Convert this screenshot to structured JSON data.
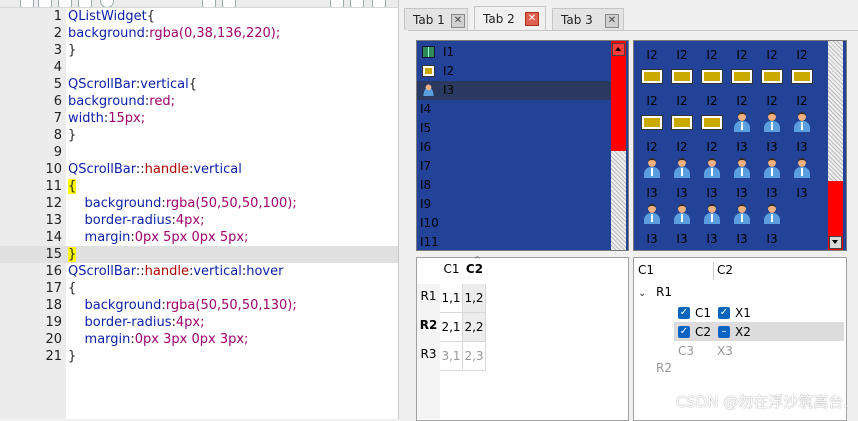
{
  "editor": {
    "lines": [
      {
        "n": "1",
        "parts": [
          [
            "sel",
            "QListWidget"
          ],
          [
            "brace",
            "{"
          ]
        ]
      },
      {
        "n": "2",
        "parts": [
          [
            "prop",
            "background"
          ],
          [
            "brace",
            ":"
          ],
          [
            "val",
            "rgba(0,38,136,220);"
          ]
        ]
      },
      {
        "n": "3",
        "parts": [
          [
            "brace",
            "}"
          ]
        ]
      },
      {
        "n": "4",
        "parts": []
      },
      {
        "n": "5",
        "parts": [
          [
            "sel",
            "QScrollBar"
          ],
          [
            "brace",
            ":"
          ],
          [
            "sel",
            "vertical"
          ],
          [
            "brace",
            "{"
          ]
        ]
      },
      {
        "n": "6",
        "parts": [
          [
            "prop",
            "background"
          ],
          [
            "brace",
            ":"
          ],
          [
            "val",
            "red;"
          ]
        ]
      },
      {
        "n": "7",
        "parts": [
          [
            "prop",
            "width"
          ],
          [
            "brace",
            ":"
          ],
          [
            "val",
            "15px;"
          ]
        ]
      },
      {
        "n": "8",
        "parts": [
          [
            "brace",
            "}"
          ]
        ]
      },
      {
        "n": "9",
        "parts": []
      },
      {
        "n": "10",
        "parts": [
          [
            "sel",
            "QScrollBar"
          ],
          [
            "brace",
            "::"
          ],
          [
            "pseudo",
            "handle"
          ],
          [
            "brace",
            ":"
          ],
          [
            "sel",
            "vertical"
          ]
        ]
      },
      {
        "n": "11",
        "parts": [
          [
            "bracehl",
            "{"
          ]
        ]
      },
      {
        "n": "12",
        "parts": [
          [
            "pad",
            "    "
          ],
          [
            "prop",
            "background"
          ],
          [
            "brace",
            ":"
          ],
          [
            "val",
            "rgba(50,50,50,100);"
          ]
        ]
      },
      {
        "n": "13",
        "parts": [
          [
            "pad",
            "    "
          ],
          [
            "prop",
            "border-radius"
          ],
          [
            "brace",
            ":"
          ],
          [
            "val",
            "4px;"
          ]
        ]
      },
      {
        "n": "14",
        "parts": [
          [
            "pad",
            "    "
          ],
          [
            "prop",
            "margin"
          ],
          [
            "brace",
            ":"
          ],
          [
            "val",
            "0px 5px 0px 5px;"
          ]
        ]
      },
      {
        "n": "15",
        "parts": [
          [
            "bracehl",
            "}"
          ]
        ],
        "current": true
      },
      {
        "n": "16",
        "parts": [
          [
            "sel",
            "QScrollBar"
          ],
          [
            "brace",
            "::"
          ],
          [
            "pseudo",
            "handle"
          ],
          [
            "brace",
            ":"
          ],
          [
            "sel",
            "vertical"
          ],
          [
            "brace",
            ":"
          ],
          [
            "sel",
            "hover"
          ]
        ]
      },
      {
        "n": "17",
        "parts": [
          [
            "brace",
            "{"
          ]
        ]
      },
      {
        "n": "18",
        "parts": [
          [
            "pad",
            "    "
          ],
          [
            "prop",
            "background"
          ],
          [
            "brace",
            ":"
          ],
          [
            "val",
            "rgba(50,50,50,130);"
          ]
        ]
      },
      {
        "n": "19",
        "parts": [
          [
            "pad",
            "    "
          ],
          [
            "prop",
            "border-radius"
          ],
          [
            "brace",
            ":"
          ],
          [
            "val",
            "4px;"
          ]
        ]
      },
      {
        "n": "20",
        "parts": [
          [
            "pad",
            "    "
          ],
          [
            "prop",
            "margin"
          ],
          [
            "brace",
            ":"
          ],
          [
            "val",
            "0px 3px 0px 3px;"
          ]
        ]
      },
      {
        "n": "21",
        "parts": [
          [
            "brace",
            "}"
          ]
        ]
      }
    ]
  },
  "tabs": [
    {
      "label": "Tab 1",
      "active": false
    },
    {
      "label": "Tab 2",
      "active": true
    },
    {
      "label": "Tab 3",
      "active": false
    }
  ],
  "list1": {
    "items": [
      {
        "label": "I1",
        "icon": "book-icon"
      },
      {
        "label": "I2",
        "icon": "flag-icon"
      },
      {
        "label": "I3",
        "icon": "person-icon",
        "selected": true
      },
      {
        "label": "I4"
      },
      {
        "label": "I5"
      },
      {
        "label": "I6"
      },
      {
        "label": "I7"
      },
      {
        "label": "I8"
      },
      {
        "label": "I9"
      },
      {
        "label": "I10"
      },
      {
        "label": "I11"
      }
    ]
  },
  "list2": {
    "rows": [
      [
        "I2",
        "I2",
        "I2",
        "I2",
        "I2",
        "I2"
      ],
      [
        "flag",
        "flag",
        "flag",
        "flag",
        "flag",
        "flag"
      ],
      [
        "I2",
        "I2",
        "I2",
        "I2",
        "I2",
        "I2"
      ],
      [
        "flag",
        "flag",
        "flag",
        "person",
        "person",
        "person"
      ],
      [
        "I2",
        "I2",
        "I2",
        "I3",
        "I3",
        "I3"
      ],
      [
        "person",
        "person",
        "person",
        "person",
        "person",
        "person"
      ],
      [
        "I3",
        "I3",
        "I3",
        "I3",
        "I3",
        "I3"
      ],
      [
        "person",
        "person",
        "person",
        "person",
        "person",
        ""
      ],
      [
        "I3",
        "I3",
        "I3",
        "I3",
        "I3",
        ""
      ]
    ]
  },
  "table": {
    "columns": [
      "C1",
      "C2"
    ],
    "rows": [
      {
        "header": "R1",
        "cells": [
          "1,1",
          "1,2"
        ]
      },
      {
        "header": "R2",
        "cells": [
          "2,1",
          "2,2"
        ]
      },
      {
        "header": "R3",
        "cells": [
          "3,1",
          "2,3"
        ]
      }
    ]
  },
  "tree": {
    "columns": [
      "C1",
      "C2"
    ],
    "root": "R1",
    "children": [
      {
        "c1": "C1",
        "c2": "X1",
        "c2type": "check"
      },
      {
        "c1": "C2",
        "c2": "X2",
        "c2type": "partial",
        "selected": true
      },
      {
        "c1": "C3",
        "c2": "X3",
        "disabled": true
      }
    ],
    "root2": "R2"
  },
  "watermark": "CSDN @勿在浮沙筑高台."
}
